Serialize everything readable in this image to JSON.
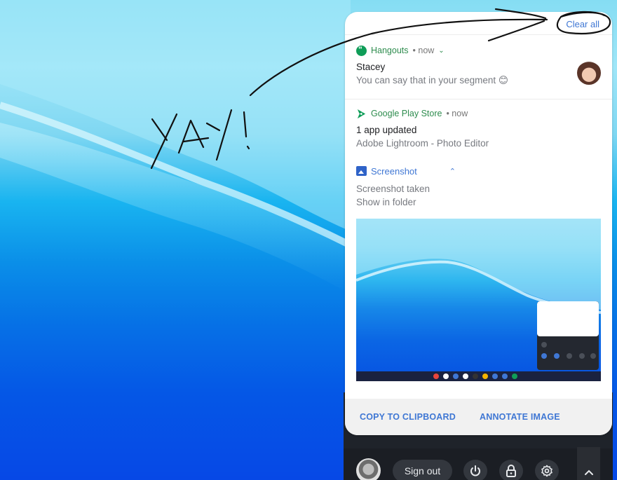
{
  "colors": {
    "accent": "#3f77d4",
    "hangouts_green": "#0f9d58",
    "app_label_green": "#2e8c4e",
    "shelf": "#1f232a",
    "ink": "#111111"
  },
  "annotation": {
    "handwritten_text": "YAY!",
    "circle_target": "Clear all"
  },
  "notification_center": {
    "clear_all_label": "Clear all",
    "notifications": [
      {
        "app": "Hangouts",
        "icon": "hangouts-icon",
        "time": "• now",
        "expand_icon": "chevron-down-icon",
        "title": "Stacey",
        "body": "You can say that in your segment 😊",
        "has_avatar": true
      },
      {
        "app": "Google Play Store",
        "icon": "play-store-icon",
        "time": "• now",
        "title": "1 app updated",
        "body": "Adobe Lightroom - Photo Editor"
      },
      {
        "app": "Screenshot",
        "icon": "image-icon",
        "collapse_icon": "chevron-up-icon",
        "title": "Screenshot taken",
        "body": "Show in folder",
        "actions": [
          "COPY TO CLIPBOARD",
          "ANNOTATE IMAGE"
        ]
      }
    ]
  },
  "system_tray": {
    "sign_out_label": "Sign out",
    "buttons": [
      "power-icon",
      "lock-icon",
      "gear-icon"
    ],
    "expand_icon": "chevron-up-icon"
  }
}
